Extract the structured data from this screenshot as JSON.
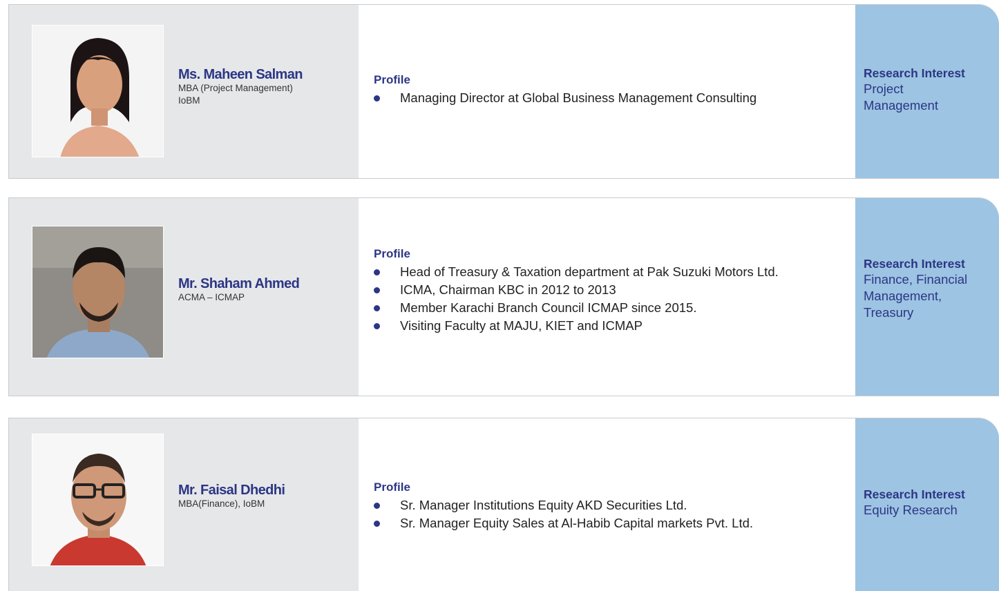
{
  "people": [
    {
      "name": "Ms. Maheen Salman",
      "qualification": [
        "MBA (Project Management)",
        "IoBM"
      ],
      "profile_title": "Profile",
      "profile": [
        "Managing Director at Global Business Management Consulting"
      ],
      "research_title": "Research Interest",
      "research": [
        "Project",
        "Management"
      ]
    },
    {
      "name": "Mr. Shaham Ahmed",
      "qualification": [
        "ACMA – ICMAP"
      ],
      "profile_title": "Profile",
      "profile": [
        "Head of Treasury & Taxation department at Pak Suzuki Motors Ltd.",
        "ICMA, Chairman KBC in 2012 to 2013",
        "Member Karachi Branch Council ICMAP since 2015.",
        "Visiting Faculty at MAJU, KIET and ICMAP"
      ],
      "research_title": "Research Interest",
      "research": [
        "Finance, Financial",
        "Management,",
        "Treasury"
      ]
    },
    {
      "name": "Mr. Faisal Dhedhi",
      "qualification": [
        "MBA(Finance), IoBM"
      ],
      "profile_title": "Profile",
      "profile": [
        "Sr. Manager Institutions Equity AKD Securities Ltd.",
        "Sr. Manager Equity Sales at Al-Habib Capital markets Pvt. Ltd."
      ],
      "research_title": "Research Interest",
      "research": [
        "Equity Research"
      ]
    }
  ]
}
